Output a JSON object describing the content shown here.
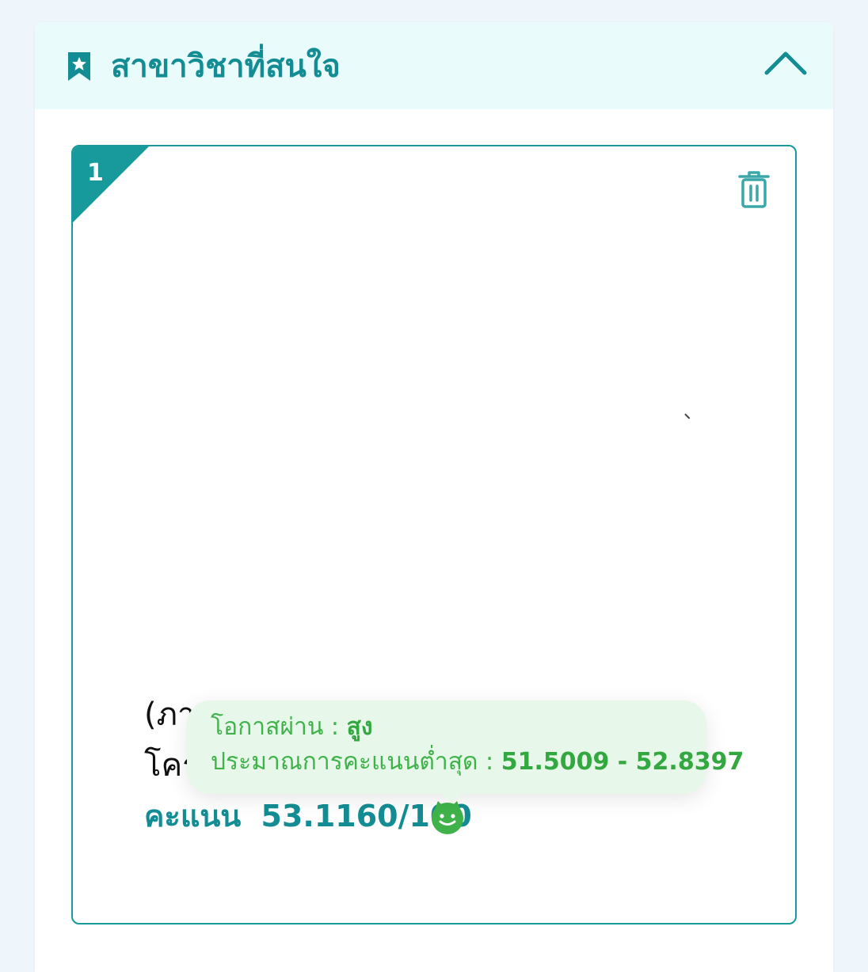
{
  "section": {
    "title": "สาขาวิชาที่สนใจ",
    "title_icon": "bookmark-star-icon",
    "toggle_icon": "chevron-up-icon"
  },
  "choice": {
    "rank": "1",
    "delete_icon": "trash-icon",
    "faculty_text": "(ภา",
    "program_text": "โคร",
    "score_label": "คะแนน",
    "score_value": "53.1160/100",
    "status_icon": "smiley-icon",
    "tooltip": {
      "chance_label": "โอกาสผ่าน :",
      "chance_value": "สูง",
      "min_score_label": "ประมาณการคะแนนต่ำสุด :",
      "min_score_value": "51.5009 - 52.8397"
    }
  },
  "colors": {
    "accent": "#138d93",
    "border": "#18999c",
    "header_bg": "#e9fbfb",
    "success": "#3fb34a",
    "tooltip_bg": "#e7f7e9"
  }
}
